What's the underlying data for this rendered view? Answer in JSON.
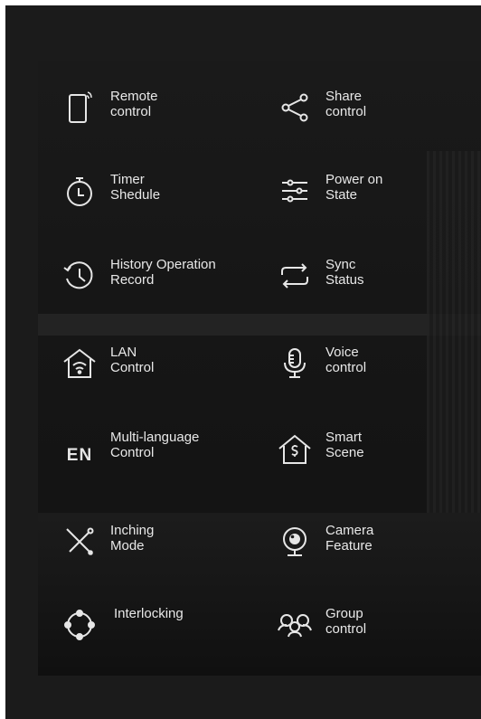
{
  "features": [
    {
      "line1": "Remote",
      "line2": "control",
      "icon": "remote-phone-icon"
    },
    {
      "line1": "Share",
      "line2": "control",
      "icon": "share-icon"
    },
    {
      "line1": "Timer",
      "line2": "Shedule",
      "icon": "timer-icon"
    },
    {
      "line1": "Power on",
      "line2": "State",
      "icon": "power-state-icon"
    },
    {
      "line1": "History Operation",
      "line2": "Record",
      "icon": "history-icon"
    },
    {
      "line1": "Sync",
      "line2": "Status",
      "icon": "sync-icon"
    },
    {
      "line1": "LAN",
      "line2": "Control",
      "icon": "lan-home-wifi-icon"
    },
    {
      "line1": "Voice",
      "line2": "control",
      "icon": "microphone-icon"
    },
    {
      "line1": "Multi-language",
      "line2": "Control",
      "icon": "language-en-icon",
      "icon_text": "EN"
    },
    {
      "line1": "Smart",
      "line2": "Scene",
      "icon": "smart-scene-home-icon"
    },
    {
      "line1": "Inching",
      "line2": "Mode",
      "icon": "inching-icon"
    },
    {
      "line1": "Camera",
      "line2": "Feature",
      "icon": "camera-icon"
    },
    {
      "line1": "Interlocking",
      "line2": "",
      "icon": "interlocking-icon"
    },
    {
      "line1": "Group",
      "line2": "control",
      "icon": "group-icon"
    }
  ],
  "colors": {
    "background": "#1b1b1b",
    "panel": "#161616",
    "text": "#e8e8e8"
  }
}
